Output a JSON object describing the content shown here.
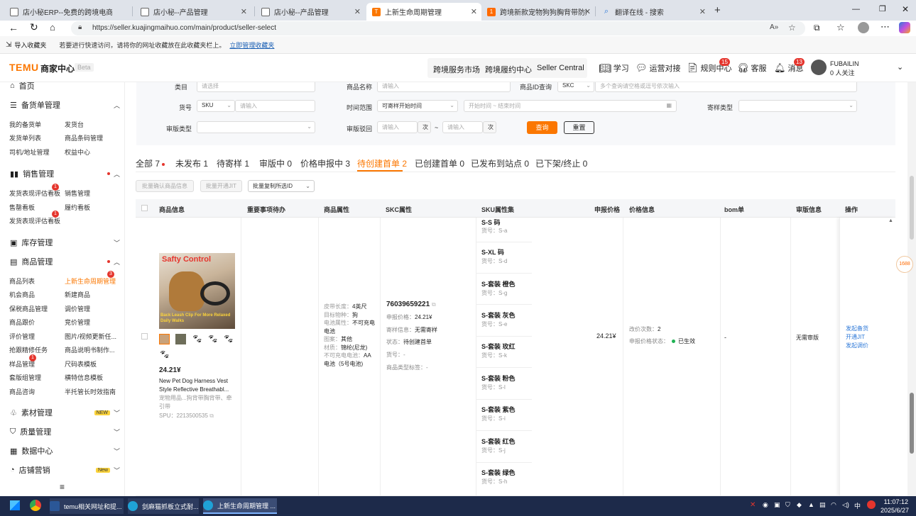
{
  "browser": {
    "tabs": [
      {
        "label": "店小秘ERP--免费的跨境电商ERP"
      },
      {
        "label": "店小秘--产品管理"
      },
      {
        "label": "店小秘--产品管理"
      },
      {
        "label": "上新生命周期管理"
      },
      {
        "label": "跨境新款宠物狗狗胸背带防爆冲牵"
      },
      {
        "label": "翻译在线 - 搜索"
      }
    ],
    "url": "https://seller.kuajingmaihuo.com/main/product/seller-select",
    "favbar": {
      "import_label": "导入收藏夹",
      "hint": "若要进行快速访问，请将你的网址收藏放在此收藏夹栏上。",
      "manage_link": "立即管理收藏夹"
    }
  },
  "header": {
    "logo": "TEMU",
    "title": "商家中心",
    "beta": "Beta",
    "nav": [
      "跨境服务市场",
      "跨境履约中心",
      "Seller Central"
    ],
    "actions": {
      "learn": "学习",
      "ops": "运营对接",
      "rules": "规则中心",
      "rules_badge": "15",
      "service": "客服",
      "messages": "消息",
      "messages_badge": "13"
    },
    "user": {
      "name": "FUBAILIN",
      "followers": "0 人关注"
    }
  },
  "sidebar": {
    "home": "首页",
    "sections": [
      {
        "title": "备货单管理",
        "items": [
          "我的备货单",
          "发货台",
          "发货单列表",
          "商品条码管理",
          "司机/地址管理",
          "权益中心"
        ]
      },
      {
        "title": "销售管理",
        "items": [
          "发货表现评估看板",
          "销售管理",
          "售罄看板",
          "履约看板",
          "发货表现评估看板"
        ],
        "badges": [
          "1",
          "1"
        ]
      },
      {
        "title": "库存管理"
      },
      {
        "title": "商品管理",
        "items": [
          "商品列表",
          "上新生命周期管理",
          "机会商品",
          "新建商品",
          "保税商品管理",
          "调价管理",
          "商品跟价",
          "竞价管理",
          "评价管理",
          "图片/视频更新任...",
          "抢跟精修任务",
          "商品说明书制作...",
          "样品管理",
          "尺码表模板",
          "套版组管理",
          "横特信息模板",
          "商品咨询",
          "半托管长时效指南"
        ],
        "badges": [
          "3",
          "1"
        ]
      },
      {
        "title": "素材管理",
        "tag": "NEW"
      },
      {
        "title": "质量管理"
      },
      {
        "title": "数据中心"
      },
      {
        "title": "店铺营销",
        "tag": "New"
      }
    ]
  },
  "filters": {
    "row1": {
      "category_label": "类目",
      "category_placeholder": "请选择",
      "name_label": "商品名称",
      "name_placeholder": "请输入",
      "id_label": "商品ID查询",
      "id_type": "SKC",
      "id_placeholder": "多个查询请空格或逗号依次输入"
    },
    "row2": {
      "sku_label": "货号",
      "sku_type": "SKU",
      "sku_placeholder": "请输入",
      "time_label": "时间范围",
      "time_type": "可寄样开始时间",
      "time_placeholder": "开始时间  ~  结束时间",
      "sample_label": "寄样类型"
    },
    "row3": {
      "review_label": "审版类型",
      "reject_label": "审版驳回",
      "reject_from": "请输入",
      "unit1": "次",
      "sep": "~",
      "reject_to": "请输入",
      "unit2": "次",
      "search": "查询",
      "reset": "重置"
    }
  },
  "status_tabs": [
    {
      "label": "全部 7",
      "dot": true
    },
    {
      "label": "未发布 1"
    },
    {
      "label": "待寄样 1"
    },
    {
      "label": "审版中 0"
    },
    {
      "label": "价格申报中 3"
    },
    {
      "label": "待创建首单 2",
      "active": true
    },
    {
      "label": "已创建首单 0"
    },
    {
      "label": "已发布到站点 0"
    },
    {
      "label": "已下架/终止 0"
    }
  ],
  "bulk_actions": {
    "confirm": "批量确认商品信息",
    "jit": "批量开通JIT",
    "copy": "批量复制所选ID"
  },
  "table": {
    "columns": [
      "商品信息",
      "重要事项待办",
      "商品属性",
      "SKC属性",
      "SKU属性集",
      "申报价格",
      "价格信息",
      "bom单",
      "审版信息",
      "操作"
    ],
    "product": {
      "image_text_top": "Safty  Control",
      "image_text_bottom": "Back Leash Clip For More Relaxed Daily Walks",
      "price": "24.21¥",
      "name": "New Pet Dog Harness Vest Style Reflective Breathabl...",
      "category": "宠物用品...狗背带胸背带、牵引带",
      "spu": "SPU：2213500535"
    },
    "attrs": [
      {
        "k": "皮带长度：",
        "v": "4英尺"
      },
      {
        "k": "目标物种：",
        "v": "狗"
      },
      {
        "k": "电池属性：",
        "v": "不可充电电池"
      },
      {
        "k": "图案：",
        "v": "其他"
      },
      {
        "k": "材质：",
        "v": "锦纶(尼龙)"
      },
      {
        "k": "不可充电电池：",
        "v": "AA电池（5号电池)"
      }
    ],
    "skc": {
      "id": "76039659221",
      "declare": "申报价格：",
      "declare_v": "24.21¥",
      "sample": "寄样信息：",
      "sample_v": "无需寄样",
      "status": "状态：",
      "status_v": "待创建首单",
      "code": "货号：",
      "code_v": "-",
      "tag": "商品类型标签：",
      "tag_v": "-"
    },
    "skus": [
      {
        "name": "S-S 码",
        "code": "货号：S-a"
      },
      {
        "name": "S-XL 码",
        "code": "货号：S-d"
      },
      {
        "name": "S-套装 橙色",
        "code": "货号：S-g"
      },
      {
        "name": "S-套装 灰色",
        "code": "货号：S-e"
      },
      {
        "name": "S-套装 玫红",
        "code": "货号：S-k"
      },
      {
        "name": "S-套装 粉色",
        "code": "货号：S-l"
      },
      {
        "name": "S-套装 紫色",
        "code": "货号：S-i"
      },
      {
        "name": "S-套装 红色",
        "code": "货号：S-j"
      },
      {
        "name": "S-套装 绿色",
        "code": "货号：S-h"
      }
    ],
    "declare_price": "24.21¥",
    "price_info": {
      "changes_k": "改价次数：",
      "changes_v": "2",
      "status_k": "申报价格状态：",
      "status_v": "已生效"
    },
    "bom": "-",
    "review": "无需审版",
    "ops": [
      "发起备货",
      "开通JIT",
      "发起调价"
    ]
  },
  "taskbar": {
    "apps": [
      "temu相关网址和提...",
      "剑麻猫抓板立式耐...",
      "上新生命周期管理 ..."
    ],
    "time": "11:07:12",
    "date": "2025/6/27",
    "lang": "中"
  },
  "colors": {
    "accent": "#fb7701",
    "link": "#2f7ad8",
    "badge": "#e5352d",
    "ok": "#1fb254"
  }
}
